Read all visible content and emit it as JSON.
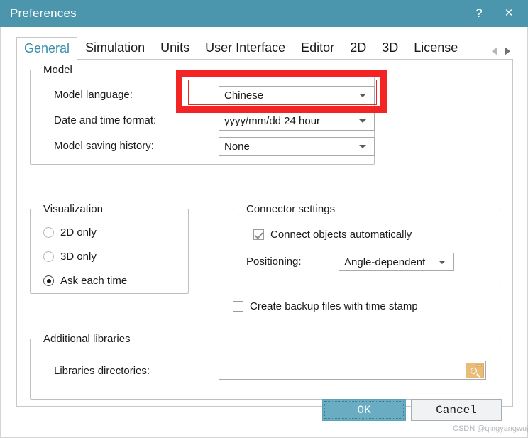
{
  "window": {
    "title": "Preferences",
    "help_icon": "?",
    "close_icon": "×",
    "titlebar_color": "#4b96ad"
  },
  "tabs": {
    "items": [
      {
        "label": "General",
        "active": true
      },
      {
        "label": "Simulation",
        "active": false
      },
      {
        "label": "Units",
        "active": false
      },
      {
        "label": "User Interface",
        "active": false
      },
      {
        "label": "Editor",
        "active": false
      },
      {
        "label": "2D",
        "active": false
      },
      {
        "label": "3D",
        "active": false
      },
      {
        "label": "License",
        "active": false
      }
    ],
    "scroll_prev": "◀",
    "scroll_next": "▶"
  },
  "model_group": {
    "title": "Model",
    "language_label": "Model language:",
    "language_value": "Chinese",
    "datetime_label": "Date and time format:",
    "datetime_value": "yyyy/mm/dd  24 hour",
    "saving_history_label": "Model saving history:",
    "saving_history_value": "None"
  },
  "visualization_group": {
    "title": "Visualization",
    "options": [
      {
        "label": "2D only",
        "selected": false
      },
      {
        "label": "3D only",
        "selected": false
      },
      {
        "label": "Ask each time",
        "selected": true
      }
    ]
  },
  "connector_group": {
    "title": "Connector settings",
    "connect_auto_label": "Connect objects automatically",
    "connect_auto_checked": true,
    "positioning_label": "Positioning:",
    "positioning_value": "Angle-dependent"
  },
  "backup": {
    "label": "Create backup files with time stamp",
    "checked": false
  },
  "libraries_group": {
    "title": "Additional libraries",
    "directories_label": "Libraries directories:",
    "directories_value": "",
    "browse_icon": "folder-search-icon"
  },
  "footer": {
    "ok_label": "OK",
    "cancel_label": "Cancel",
    "ok_color": "#6aadc2"
  },
  "watermark": {
    "text": "CSDN @qingyangwuji"
  },
  "annotation": {
    "color": "#f22424"
  }
}
